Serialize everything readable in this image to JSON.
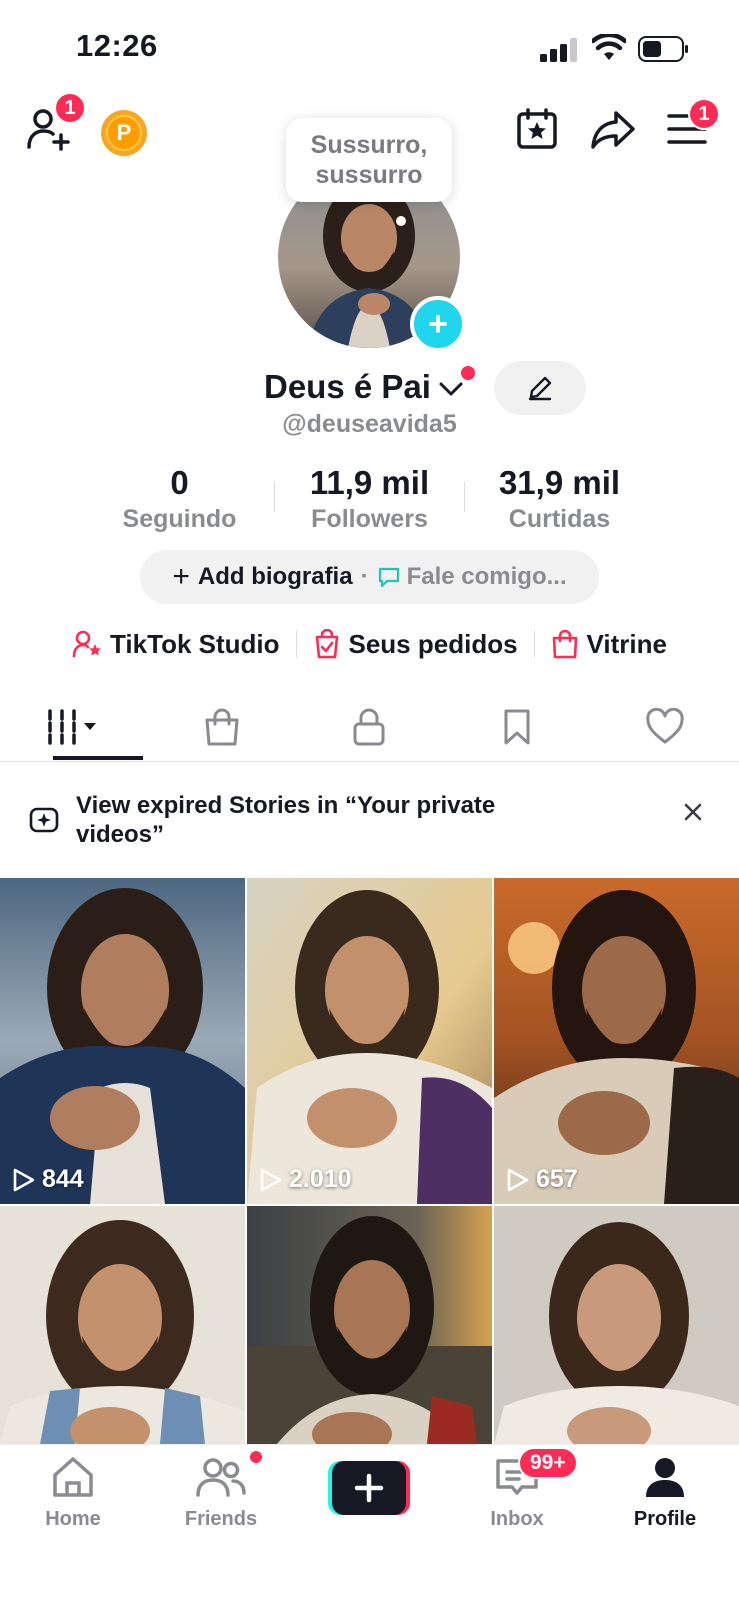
{
  "status_bar": {
    "time": "12:26"
  },
  "top_bar": {
    "add_friends_badge": "1",
    "coin_letter": "P",
    "menu_badge": "1"
  },
  "profile": {
    "note_bubble": "Sussurro, sussurro",
    "name": "Deus é Pai",
    "handle": "@deuseavida5"
  },
  "stats": [
    {
      "value": "0",
      "label": "Seguindo"
    },
    {
      "value": "11,9 mil",
      "label": "Followers"
    },
    {
      "value": "31,9 mil",
      "label": "Curtidas"
    }
  ],
  "bio": {
    "add_label": "Add biografia",
    "separator": "·",
    "chat_label": "Fale comigo..."
  },
  "links": [
    {
      "label": "TikTok Studio",
      "icon": "person-star-icon"
    },
    {
      "label": "Seus pedidos",
      "icon": "order-bag-icon"
    },
    {
      "label": "Vitrine",
      "icon": "shopping-bag-icon"
    }
  ],
  "banner": {
    "text": "View expired Stories in “Your private videos”"
  },
  "videos": [
    {
      "views": "844"
    },
    {
      "views": "2.010"
    },
    {
      "views": "657"
    },
    {
      "views": ""
    },
    {
      "views": ""
    },
    {
      "views": ""
    }
  ],
  "nav": {
    "home": "Home",
    "friends": "Friends",
    "inbox": "Inbox",
    "inbox_badge": "99+",
    "profile": "Profile"
  },
  "colors": {
    "accent": "#fe2c55",
    "cyan": "#20d5ec",
    "text": "#161823",
    "muted": "#8a8b91"
  }
}
